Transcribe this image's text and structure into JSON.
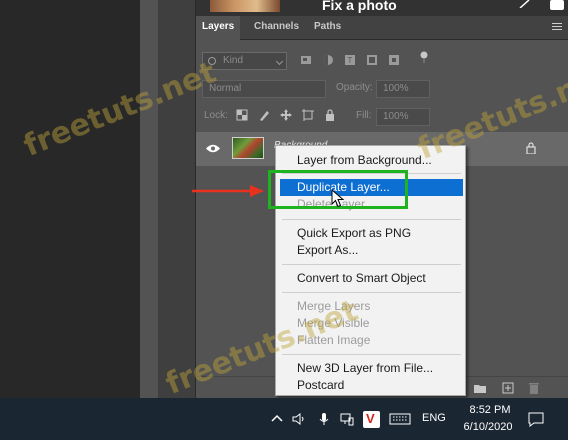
{
  "top": {
    "title": "Fix a photo"
  },
  "tabs": [
    {
      "label": "Layers",
      "active": true
    },
    {
      "label": "Channels",
      "active": false
    },
    {
      "label": "Paths",
      "active": false
    }
  ],
  "filter": {
    "kind_placeholder": "Kind"
  },
  "blend": {
    "mode": "Normal",
    "opacity_label": "Opacity:",
    "opacity_value": "100%"
  },
  "lock": {
    "label": "Lock:",
    "fill_label": "Fill:",
    "fill_value": "100%"
  },
  "layer": {
    "name": "Background"
  },
  "context_menu": {
    "items": [
      {
        "label": "Layer from Background...",
        "state": "normal"
      },
      {
        "label": "Duplicate Layer...",
        "state": "highlight"
      },
      {
        "label": "Delete Layer",
        "state": "disabled"
      },
      {
        "label": "Quick Export as PNG",
        "state": "normal"
      },
      {
        "label": "Export As...",
        "state": "normal"
      },
      {
        "label": "Convert to Smart Object",
        "state": "normal"
      },
      {
        "label": "Merge Layers",
        "state": "disabled"
      },
      {
        "label": "Merge Visible",
        "state": "disabled"
      },
      {
        "label": "Flatten Image",
        "state": "disabled"
      },
      {
        "label": "New 3D Layer from File...",
        "state": "normal"
      },
      {
        "label": "Postcard",
        "state": "normal"
      }
    ]
  },
  "taskbar": {
    "language": "ENG",
    "time": "8:52 PM",
    "date": "6/10/2020",
    "tray_icons": [
      "chevron-up-icon",
      "volume-icon",
      "microphone-icon",
      "network-icon",
      "vivaldi-icon",
      "keyboard-icon",
      "notification-icon"
    ]
  },
  "watermark": {
    "text": "freetuts.net"
  },
  "colors": {
    "highlight": "#0d6fd1",
    "annotation_box": "#1fb31f",
    "annotation_arrow": "#e8321e"
  }
}
